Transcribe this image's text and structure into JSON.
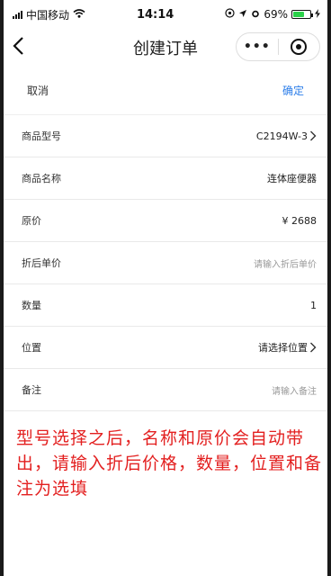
{
  "status_bar": {
    "carrier": "中国移动",
    "time": "14:14",
    "battery": "69%",
    "battery_level": 0.69
  },
  "nav": {
    "title": "创建订单",
    "more_label": "•••"
  },
  "actions": {
    "cancel": "取消",
    "confirm": "确定"
  },
  "form": {
    "model_label": "商品型号",
    "model_value": "C2194W-3",
    "name_label": "商品名称",
    "name_value": "连体座便器",
    "price_label": "原价",
    "price_value": "¥ 2688",
    "discount_label": "折后单价",
    "discount_placeholder": "请输入折后单价",
    "qty_label": "数量",
    "qty_value": "1",
    "location_label": "位置",
    "location_value": "请选择位置",
    "remark_label": "备注",
    "remark_placeholder": "请输入备注"
  },
  "annotation": "型号选择之后，名称和原价会自动带出，请输入折后价格，数量，位置和备注为选填",
  "colors": {
    "accent": "#2b7de9",
    "annotation": "#e32020",
    "battery": "#2bd24a"
  }
}
